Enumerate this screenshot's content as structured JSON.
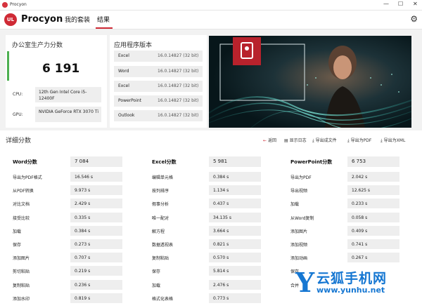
{
  "window": {
    "title": "Procyon",
    "min": "—",
    "max": "☐",
    "close": "✕"
  },
  "header": {
    "logo_badge": "UL",
    "logo_text": "Procyon",
    "tabs": [
      "我的套装",
      "结果"
    ],
    "settings_icon": "gear-icon"
  },
  "summary": {
    "title": "办公室生产力分数",
    "score": "6 191",
    "cpu_label": "CPU:",
    "cpu_value": "12th Gen Intel Core i5-12400F",
    "gpu_label": "GPU:",
    "gpu_value": "NVIDIA GeForce RTX 3070 Ti"
  },
  "versions": {
    "title": "应用程序版本",
    "rows": [
      {
        "name": "Excel",
        "value": "16.0.14827 (32 bit)"
      },
      {
        "name": "Word",
        "value": "16.0.14827 (32 bit)"
      },
      {
        "name": "Excel",
        "value": "16.0.14827 (32 bit)"
      },
      {
        "name": "PowerPoint",
        "value": "16.0.14827 (32 bit)"
      },
      {
        "name": "Outlook",
        "value": "16.0.14827 (32 bit)"
      }
    ]
  },
  "details": {
    "title": "详细分数",
    "actions": [
      "返回",
      "显示日志",
      "导出成文件",
      "导出为PDF",
      "导出为XML"
    ],
    "columns": [
      {
        "name": "Word分数",
        "score": "7 084",
        "rows": [
          {
            "name": "导出为PDF格式",
            "value": "16.546 s"
          },
          {
            "name": "从PDF转换",
            "value": "9.973 s"
          },
          {
            "name": "对比文档",
            "value": "2.429 s"
          },
          {
            "name": "接受比较",
            "value": "0.335 s"
          },
          {
            "name": "加载",
            "value": "0.384 s"
          },
          {
            "name": "保存",
            "value": "0.273 s"
          },
          {
            "name": "添加图片",
            "value": "0.707 s"
          },
          {
            "name": "剪切粘贴",
            "value": "0.219 s"
          },
          {
            "name": "复制粘贴",
            "value": "0.236 s"
          },
          {
            "name": "添加水印",
            "value": "0.819 s"
          }
        ]
      },
      {
        "name": "Excel分数",
        "score": "5 981",
        "rows": [
          {
            "name": "编辑单元格",
            "value": "0.384 s"
          },
          {
            "name": "按列排序",
            "value": "1.134 s"
          },
          {
            "name": "假事分析",
            "value": "0.437 s"
          },
          {
            "name": "唯一配对",
            "value": "34.135 s"
          },
          {
            "name": "解方程",
            "value": "3.664 s"
          },
          {
            "name": "数据透视表",
            "value": "0.821 s"
          },
          {
            "name": "复制粘贴",
            "value": "0.570 s"
          },
          {
            "name": "保存",
            "value": "5.814 s"
          },
          {
            "name": "加载",
            "value": "2.476 s"
          },
          {
            "name": "格式化表格",
            "value": "0.773 s"
          }
        ]
      },
      {
        "name": "PowerPoint分数",
        "score": "6 753",
        "rows": [
          {
            "name": "导出为PDF",
            "value": "2.042 s"
          },
          {
            "name": "导出视频",
            "value": "12.625 s"
          },
          {
            "name": "加载",
            "value": "0.233 s"
          },
          {
            "name": "从Word复制",
            "value": "0.058 s"
          },
          {
            "name": "添加图片",
            "value": "0.409 s"
          },
          {
            "name": "添加视频",
            "value": "0.741 s"
          },
          {
            "name": "添加动画",
            "value": "0.267 s"
          },
          {
            "name": "保存",
            "value": ""
          },
          {
            "name": "合并",
            "value": ""
          },
          {
            "name": "",
            "value": ""
          }
        ]
      }
    ]
  },
  "watermark": {
    "letter": "Y",
    "text": "云狐手机网",
    "url": "www.yunhu.net"
  },
  "colors": {
    "accent": "#cf2a35",
    "score_bar": "#4caf50",
    "watermark": "#1677d2"
  }
}
